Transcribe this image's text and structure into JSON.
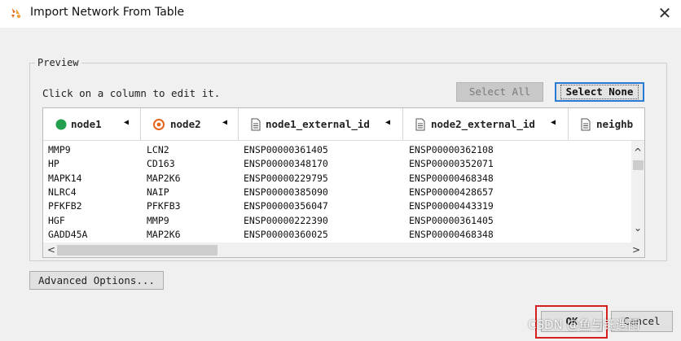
{
  "window": {
    "title": "Import Network From Table",
    "close_glyph": "✕",
    "icon": "cytoscape-app-icon"
  },
  "preview": {
    "legend": "Preview",
    "hint": "Click on a column to edit it.",
    "select_all_label": "Select All",
    "select_none_label": "Select None"
  },
  "table": {
    "columns": [
      {
        "label": "node1",
        "icon": "source-node-icon",
        "icon_color": "#22a050"
      },
      {
        "label": "node2",
        "icon": "target-node-icon",
        "icon_color": "#e8631a"
      },
      {
        "label": "node1_external_id",
        "icon": "document-icon"
      },
      {
        "label": "node2_external_id",
        "icon": "document-icon"
      },
      {
        "label": "neighb",
        "icon": "document-icon"
      }
    ],
    "rows": [
      [
        "MMP9",
        "LCN2",
        "ENSP00000361405",
        "ENSP00000362108"
      ],
      [
        "HP",
        "CD163",
        "ENSP00000348170",
        "ENSP00000352071"
      ],
      [
        "MAPK14",
        "MAP2K6",
        "ENSP00000229795",
        "ENSP00000468348"
      ],
      [
        "NLRC4",
        "NAIP",
        "ENSP00000385090",
        "ENSP00000428657"
      ],
      [
        "PFKFB2",
        "PFKFB3",
        "ENSP00000356047",
        "ENSP00000443319"
      ],
      [
        "HGF",
        "MMP9",
        "ENSP00000222390",
        "ENSP00000361405"
      ],
      [
        "GADD45A",
        "MAP2K6",
        "ENSP00000360025",
        "ENSP00000468348"
      ]
    ],
    "column_menu_glyph": "◀",
    "scroll_up_glyph": "^",
    "scroll_down_glyph": "⌄",
    "scroll_left_glyph": "<",
    "scroll_right_glyph": ">"
  },
  "buttons": {
    "advanced_label": "Advanced Options...",
    "ok_label": "OK",
    "cancel_label": "Cancel"
  },
  "watermark": "CSDN @鱼与钰遇雨",
  "colors": {
    "highlight": "#d62020",
    "focus": "#2b7ad6"
  }
}
